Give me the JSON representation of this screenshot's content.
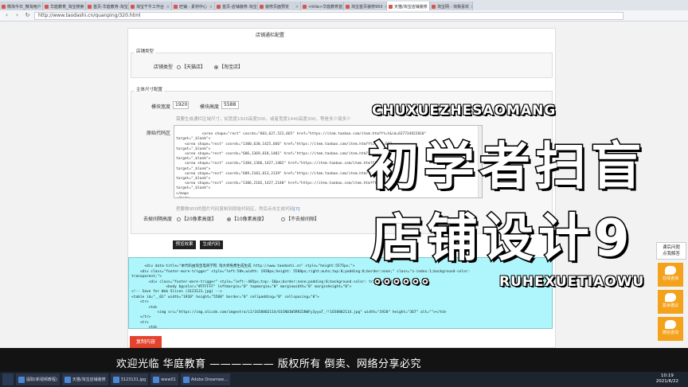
{
  "tabs": [
    {
      "label": "微淘今日_微淘用户",
      "active": false
    },
    {
      "label": "华庭教育_淘宝搜索",
      "active": false
    },
    {
      "label": "首页-华庭教育-淘宝",
      "active": false
    },
    {
      "label": "淘宝千牛工作台",
      "active": false
    },
    {
      "label": "旺铺 - 素材中心",
      "active": false
    },
    {
      "label": "首页-店铺装修-淘宝",
      "active": false
    },
    {
      "label": "装修页面预览",
      "active": false
    },
    {
      "label": "<title>华庭教育首页",
      "active": false
    },
    {
      "label": "淘宝首页装修950",
      "active": false
    },
    {
      "label": "天猫/淘宝店铺装修",
      "active": true
    },
    {
      "label": "淘宝网 - 淘我喜欢",
      "active": false
    }
  ],
  "address": {
    "url": "http://www.taodashi.cn/quanping/320.html"
  },
  "page": {
    "config_title": "店铺通栏配置",
    "shop_type": {
      "legend": "店铺类型",
      "label": "店铺类型",
      "options": [
        "【天猫店】",
        "【淘宝店】"
      ],
      "selected": 1
    },
    "size": {
      "legend": "主体尺寸配置",
      "width_label": "模块宽度",
      "width_value": "1920",
      "height_label": "模块高度",
      "height_value": "5588",
      "hint": "需要生成通栏区域尺寸，如宽度1920高度500，或者宽度1440高度300，等是多少填多少"
    },
    "source": {
      "label": "原始代码区",
      "code": "    <area shape=\"rect\" coords=\"603,627,522,665\" href=\"https://item.taobao.com/item.htm?ft=t&id=637734922010\"\ntarget=\"_blank\">\n    <area shape=\"rect\" coords=\"1300,630,1425,666\" href=\"https://item.taobao.com/item.htm?ft=t&id=637\ntarget=\"_blank\">\n    <area shape=\"rect\" coords=\"606,1369,818,1401\" href=\"https://item.taobao.com/item.htm?ft=t&id=702\ntarget=\"_blank\">\n    <area shape=\"rect\" coords=\"1304,1366,1427,1402\" href=\"https://item.taobao.com/item.htm?ft=t&id=6\ntarget=\"_blank\">\n    <area shape=\"rect\" coords=\"609,2101,813,2139\" href=\"https://item.taobao.com/item.htm?ft=t&id=617\ntarget=\"_blank\">\n    <area shape=\"rect\" coords=\"1306,2102,1427,2140\" href=\"https://item.taobao.com/item.htm?ft=t&id=6\ntarget=\"_blank\">\n</map>\n</body>",
      "paste_hint": "把要做950的图片代码复制到原始代码区，然后点击生成代码",
      "paste_hint_link": "[?]"
    },
    "gap": {
      "label": "去掉间隔高度",
      "options": [
        "【20像素高度】",
        "【10像素高度】",
        "【不去掉间隙】"
      ],
      "selected": 1
    },
    "buttons": {
      "preview": "预览效果",
      "generate": "生成代码",
      "copy": "复制内容"
    },
    "output": {
      "code": "<div data-title=\"本代码由淘宝电商学院 淘大师免费生成生成 http://www.taodashi.cn\" style=\"height:5575px;\">\n    <div class=\"footer-more-trigger\" style=\"left:50%;width: 1920px;height: 5588px;right:auto;top:0;padding:0;border:none;\" class=\"z-index:1;background-color:\ntransparent;\">\n        <div class=\"footer-more-trigger\" style=\"left:-485px;top:-10px;border:none;padding:0;background-color: transparent;\">\n                <body bgcolor=\"#FFFFFF\" leftmargin=\"0\" topmargin=\"0\" marginwidth=\"0\" marginheight=\"0\">\n<!-- Save for Web Slices (3123131.jpg) -->\n<table id=\"__01\" width=\"1920\" height=\"5588\" border=\"0\" cellpadding=\"0\" cellspacing=\"0\">\n    <tr>\n        <td>\n            <img src=\"https://img.alicdn.com/imgextra/i2/1658802114/O1CN01W5RRZ1N0Fy3yyuT_!!1658802114.jpg\" width=\"1920\" height=\"367\" alt=\"\"></td>\n    </tr>\n    <tr>\n        <td>\n            <img src=\"https://img.alicdn.com/imgextra/i4/1658802114/O1CN014uo4gh1N0Fy3901gg_!!1658802114.jpg\" width=\"1920\" height=\"1327\" alt=\"\"></td>\n    </tr>"
    }
  },
  "overlay": {
    "pinyin_top": "CHUXUEZHESAOMANG",
    "title_line1": "初学者扫盲",
    "title_line2": "店铺设计9",
    "pinyin_bottom": "RUHEXUETIAOWU",
    "dots": "。。。。。。"
  },
  "side_widget": {
    "help": [
      "课后问题",
      "点我解答"
    ],
    "buttons": [
      "在线咨询",
      "投诉建议",
      "微信咨询"
    ]
  },
  "banner": {
    "text": "欢迎光临  华庭教育  ——————  版权所有  倒卖、网络分享必究"
  },
  "taskbar": {
    "items": [
      "提取(新视频教程)",
      "天猫/淘宝店铺装修",
      "3123131.jpg",
      "www01",
      "Adobe Dreamwe..."
    ],
    "time": "10:19",
    "date": "2021/6/22"
  }
}
